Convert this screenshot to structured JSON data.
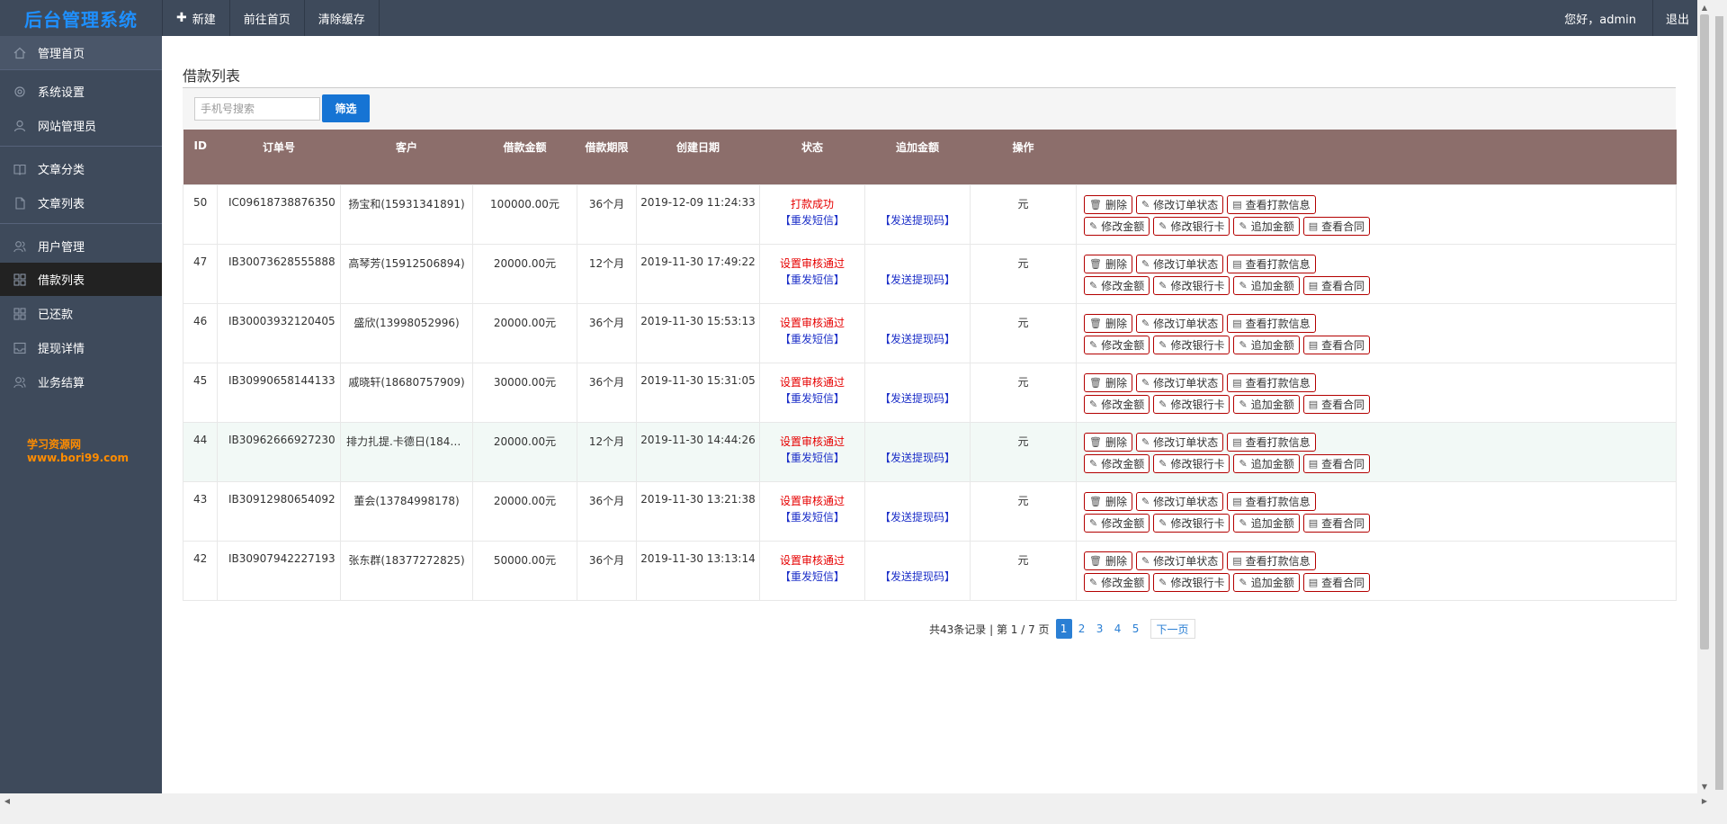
{
  "app": {
    "brand": "后台管理系统"
  },
  "topnav": [
    {
      "label": "新建",
      "icon": "plus-icon"
    },
    {
      "label": "前往首页"
    },
    {
      "label": "清除缓存"
    }
  ],
  "user": {
    "greeting": "您好，admin",
    "logout": "退出"
  },
  "sidebar": {
    "items": [
      {
        "label": "管理首页",
        "icon": "home-icon"
      },
      {
        "label": "系统设置",
        "icon": "gear-icon"
      },
      {
        "label": "网站管理员",
        "icon": "user-icon"
      },
      {
        "label": "文章分类",
        "icon": "book-icon"
      },
      {
        "label": "文章列表",
        "icon": "file-icon"
      },
      {
        "label": "用户管理",
        "icon": "users-icon"
      },
      {
        "label": "借款列表",
        "icon": "grid-icon"
      },
      {
        "label": "已还款",
        "icon": "grid-icon"
      },
      {
        "label": "提现详情",
        "icon": "inbox-icon"
      },
      {
        "label": "业务结算",
        "icon": "users-icon"
      }
    ],
    "watermark": "学习资源网www.bori99.com"
  },
  "page": {
    "title": "借款列表",
    "search_placeholder": "手机号搜索",
    "filter_button": "筛选"
  },
  "table": {
    "headers": [
      "ID",
      "订单号",
      "客户",
      "借款金额",
      "借款期限",
      "创建日期",
      "状态",
      "追加金额",
      "操作"
    ],
    "resend_sms": "【重发短信】",
    "send_code": "【发送提现码】",
    "unit": "元",
    "ops": [
      "删除",
      "修改订单状态",
      "查看打款信息",
      "修改金额",
      "修改银行卡",
      "追加金额",
      "查看合同"
    ],
    "rows": [
      {
        "id": "50",
        "order": "IC09618738876350",
        "client": "扬宝和(15931341891)",
        "amount": "100000.00元",
        "term": "36个月",
        "date": "2019-12-09 11:24:33",
        "status": "打款成功"
      },
      {
        "id": "47",
        "order": "IB30073628555888",
        "client": "高琴芳(15912506894)",
        "amount": "20000.00元",
        "term": "12个月",
        "date": "2019-11-30 17:49:22",
        "status": "设置审核通过"
      },
      {
        "id": "46",
        "order": "IB30003932120405",
        "client": "盛欣(13998052996)",
        "amount": "20000.00元",
        "term": "36个月",
        "date": "2019-11-30 15:53:13",
        "status": "设置审核通过"
      },
      {
        "id": "45",
        "order": "IB30990658144133",
        "client": "戚晓轩(18680757909)",
        "amount": "30000.00元",
        "term": "36个月",
        "date": "2019-11-30 15:31:05",
        "status": "设置审核通过"
      },
      {
        "id": "44",
        "order": "IB30962666927230",
        "client": "排力扎提.卡德日(18443…",
        "amount": "20000.00元",
        "term": "12个月",
        "date": "2019-11-30 14:44:26",
        "status": "设置审核通过"
      },
      {
        "id": "43",
        "order": "IB30912980654092",
        "client": "董会(13784998178)",
        "amount": "20000.00元",
        "term": "36个月",
        "date": "2019-11-30 13:21:38",
        "status": "设置审核通过"
      },
      {
        "id": "42",
        "order": "IB30907942227193",
        "client": "张东群(18377272825)",
        "amount": "50000.00元",
        "term": "36个月",
        "date": "2019-11-30 13:13:14",
        "status": "设置审核通过"
      }
    ]
  },
  "pager": {
    "info": "共43条记录 | 第 1 / 7 页",
    "pages": [
      "1",
      "2",
      "3",
      "4",
      "5"
    ],
    "current": "1",
    "next": "下一页"
  }
}
